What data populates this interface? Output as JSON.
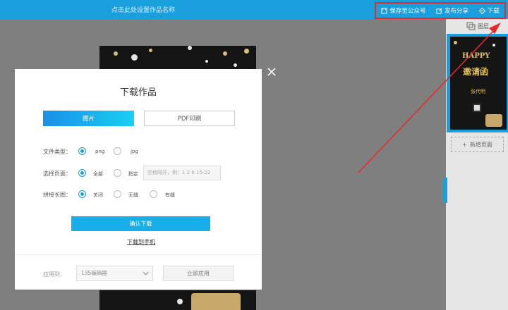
{
  "header": {
    "title": "点击此处设置作品名称",
    "actions": [
      {
        "label": "保存至公众号",
        "icon": "save-icon"
      },
      {
        "label": "发布分享",
        "icon": "share-icon"
      },
      {
        "label": "下载",
        "icon": "download-icon"
      }
    ],
    "highlight_color": "#e52a2a",
    "bar_color": "#1a9fdd"
  },
  "right_panel": {
    "layers_label": "图层",
    "thumbnail": {
      "happy": "HAPPY",
      "invite": "邀请函",
      "name": "张代明"
    },
    "add_page_label": "新增页面"
  },
  "modal": {
    "title": "下载作品",
    "tabs": [
      {
        "label": "图片",
        "active": true
      },
      {
        "label": "PDF印刷",
        "active": false
      }
    ],
    "file_type": {
      "label": "文件类型：",
      "options": [
        "png",
        "jpg"
      ],
      "selected": "png"
    },
    "page_select": {
      "label": "选择页面：",
      "options": [
        "全部",
        "指定"
      ],
      "selected": "全部",
      "placeholder": "空格隔开，例：1 2 6 15-22"
    },
    "long_image": {
      "label": "拼接长图：",
      "options": [
        "关闭",
        "无缝",
        "有缝"
      ],
      "selected": "关闭"
    },
    "confirm_label": "确认下载",
    "phone_link": "下载到手机",
    "apply": {
      "label": "应用到：",
      "select_value": "135编辑器",
      "button_label": "立即应用"
    }
  }
}
